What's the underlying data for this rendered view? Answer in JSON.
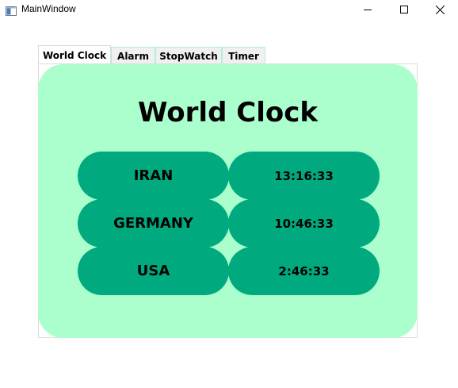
{
  "window": {
    "title": "MainWindow"
  },
  "tabs": [
    {
      "label": "World Clock",
      "active": true
    },
    {
      "label": "Alarm",
      "active": false
    },
    {
      "label": "StopWatch",
      "active": false
    },
    {
      "label": "Timer",
      "active": false
    }
  ],
  "world_clock": {
    "heading": "World Clock",
    "rows": [
      {
        "country": "IRAN",
        "time": "13:16:33"
      },
      {
        "country": "GERMANY",
        "time": "10:46:33"
      },
      {
        "country": "USA",
        "time": "2:46:33"
      }
    ]
  },
  "colors": {
    "panel_bg": "#aaffcc",
    "pill_bg": "#00aa7f"
  }
}
